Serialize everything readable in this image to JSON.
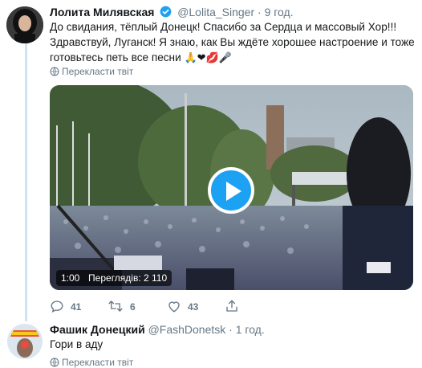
{
  "tweet": {
    "author_name": "Лолита Милявская",
    "author_handle": "@Lolita_Singer",
    "separator": "·",
    "time": "9 год.",
    "text_line1": "До свидания, тёплый Донецк! Спасибо за Сердца и массовый Хор!!!",
    "text_line2": "Здравствуй, Луганск! Я знаю, как Вы ждёте хорошее настроение и тоже",
    "text_line3": "готовьтесь петь все песни",
    "emojis": "🙏❤💋🎤",
    "translate_label": "Перекласти твіт",
    "video": {
      "duration": "1:00",
      "views_text": "Переглядів: 2 110"
    },
    "actions": {
      "replies": "41",
      "retweets": "6",
      "likes": "43"
    }
  },
  "reply": {
    "author_name": "Фашик Донецкий",
    "author_handle": "@FashDonetsk",
    "separator": "·",
    "time": "1 год.",
    "text": "Гори в аду",
    "translate_label": "Перекласти твіт"
  },
  "icons": {
    "verified": "verified-badge-icon",
    "globe": "globe-icon",
    "play": "play-icon",
    "reply": "reply-icon",
    "retweet": "retweet-icon",
    "like": "heart-icon",
    "share": "share-icon"
  },
  "colors": {
    "accent": "#1da1f2",
    "muted": "#657786",
    "thread_line": "#cfe3f4"
  }
}
